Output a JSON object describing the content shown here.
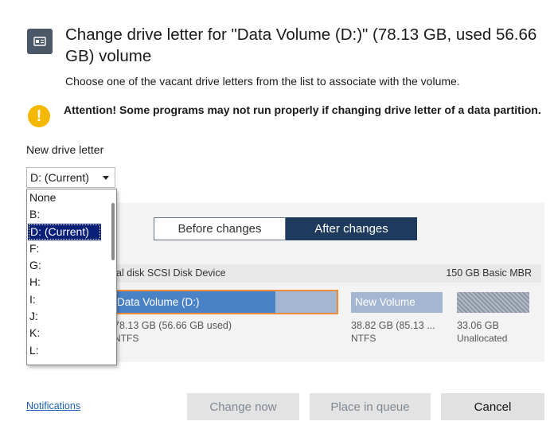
{
  "dialog": {
    "title": "Change drive letter for \"Data Volume (D:)\" (78.13 GB, used 56.66 GB) volume",
    "subtitle": "Choose one of the vacant drive letters from the list to associate with the volume.",
    "warning": "Attention! Some programs may not run properly if changing drive letter of a data partition.",
    "warning_icon": "!",
    "title_icon": "drive-letter-icon"
  },
  "drive_letter": {
    "label": "New drive letter",
    "selected": "D: (Current)",
    "options": [
      "None",
      "B:",
      "D: (Current)",
      "F:",
      "G:",
      "H:",
      "I:",
      "J:",
      "K:",
      "L:"
    ],
    "selected_index": 2
  },
  "preview": {
    "tabs": {
      "before": "Before changes",
      "after": "After changes",
      "active": "after"
    },
    "disk": {
      "name": "al disk SCSI Disk Device",
      "info": "150 GB Basic MBR"
    },
    "partitions": [
      {
        "label": "Data Volume (D:)",
        "size": "78.13 GB (56.66 GB used)",
        "fs": "NTFS",
        "used_fraction": 0.725
      },
      {
        "label": "New Volume",
        "size": "38.82 GB (85.13 ...",
        "fs": "NTFS"
      },
      {
        "label": "",
        "size": "33.06 GB",
        "fs": "Unallocated"
      }
    ]
  },
  "footer": {
    "notifications": "Notifications",
    "change_now": "Change now",
    "place_in_queue": "Place in queue",
    "cancel": "Cancel"
  },
  "colors": {
    "accent_dark": "#1e3a5c",
    "selection": "#0a1f77",
    "warning": "#f5b800",
    "partition_used": "#4a82c6",
    "partition_free": "#a3b6d2",
    "highlight_border": "#f08b3c",
    "link": "#1a5fb4"
  }
}
